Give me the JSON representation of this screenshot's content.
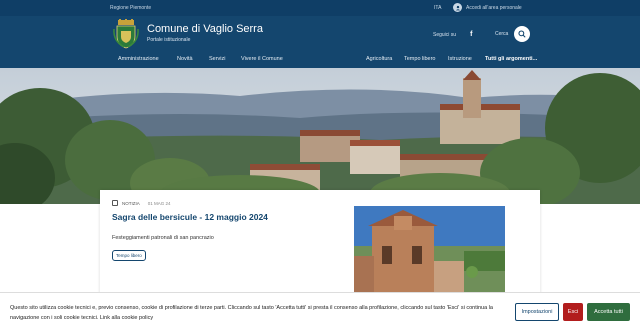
{
  "slimbar": {
    "region": "Regione Piemonte",
    "lang": "ITA",
    "login": "Accedi all'area personale"
  },
  "header": {
    "title": "Comune di Vaglio Serra",
    "subtitle": "Portale istituzionale",
    "social_label": "Seguici su",
    "search_label": "Cerca"
  },
  "nav": {
    "items": [
      "Amministrazione",
      "Novità",
      "Servizi",
      "Vivere il Comune"
    ],
    "topics": [
      "Agricoltura",
      "Tempo libero",
      "Istruzione",
      "Tutti gli argomenti..."
    ]
  },
  "news": {
    "category": "NOTIZIA",
    "date": "01 MAG 24",
    "title": "Sagra delle bersicule - 12 maggio 2024",
    "description": "Festeggiamenti patronali di san pancrazio",
    "tag": "Tempo libero"
  },
  "cookie": {
    "text": "Questo sito utilizza cookie tecnici e, previo consenso, cookie di profilazione di terze parti. Cliccando sul tasto 'Accetta tutti' si presta il consenso alla profilazione, cliccando sul tasto 'Esci' si continua la navigazione con i soli cookie tecnici. Link alla cookie policy",
    "settings": "Impostazioni",
    "exit": "Esci",
    "accept": "Accetta tutti"
  },
  "colors": {
    "primary": "#14466e",
    "slimbar": "#0f3e66",
    "exit": "#b21d1d",
    "accept": "#2f6d3e"
  },
  "icons": [
    "user-icon",
    "facebook-icon",
    "search-icon",
    "calendar-icon",
    "crest-icon"
  ]
}
